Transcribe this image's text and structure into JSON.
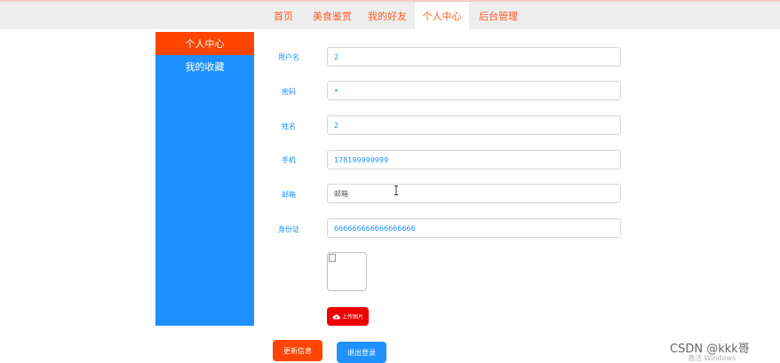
{
  "nav": {
    "items": [
      {
        "label": "首页"
      },
      {
        "label": "美食鉴赏"
      },
      {
        "label": "我的好友"
      },
      {
        "label": "个人中心"
      },
      {
        "label": "后台管理"
      }
    ],
    "active_index": 3
  },
  "sidebar": {
    "items": [
      {
        "label": "个人中心",
        "active": true
      },
      {
        "label": "我的收藏",
        "active": false
      }
    ]
  },
  "form": {
    "username": {
      "label": "用户名",
      "value": "2"
    },
    "password": {
      "label": "密码",
      "value": "•"
    },
    "name": {
      "label": "姓名",
      "value": "2"
    },
    "phone": {
      "label": "手机",
      "value": "178199999999"
    },
    "email": {
      "label": "邮箱",
      "placeholder": "邮箱",
      "value": ""
    },
    "idcard": {
      "label": "身份证",
      "value": "666666666666666666"
    }
  },
  "upload_button": {
    "label": "上传图片",
    "icon": "cloud-upload-icon"
  },
  "buttons": {
    "update": "更新信息",
    "logout": "退出登录"
  },
  "watermark": {
    "text": "CSDN @kkk哥",
    "windows": "激活 Windows"
  },
  "colors": {
    "accent": "#ff4500",
    "primary": "#1e90ff",
    "upload": "#ee0000"
  }
}
